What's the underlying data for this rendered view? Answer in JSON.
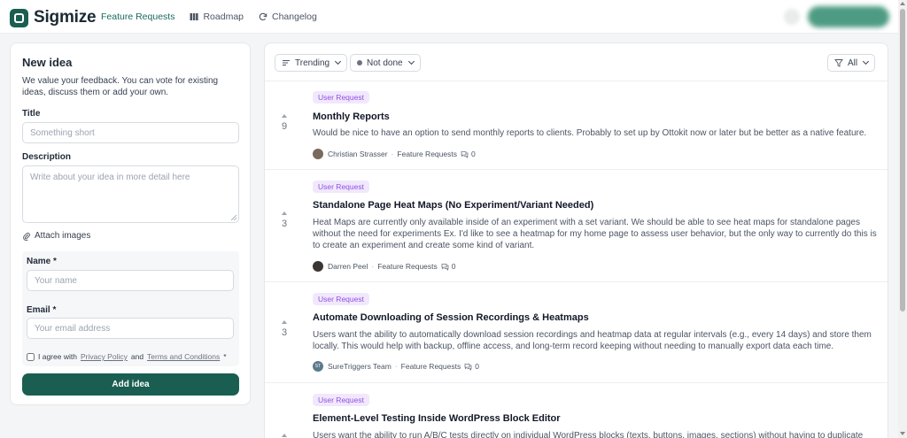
{
  "brand": {
    "name": "Sigmize",
    "color": "#1a5e52"
  },
  "nav": {
    "items": [
      {
        "label": "Feature Requests",
        "icon": "",
        "active": true
      },
      {
        "label": "Roadmap",
        "icon": "roadmap-icon",
        "active": false
      },
      {
        "label": "Changelog",
        "icon": "refresh-icon",
        "active": false
      }
    ]
  },
  "new_idea": {
    "title": "New idea",
    "description": "We value your feedback. You can vote for existing ideas, discuss them or add your own.",
    "title_label": "Title",
    "title_placeholder": "Something short",
    "description_label": "Description",
    "description_placeholder": "Write about your idea in more detail here",
    "attach_label": "Attach images",
    "name_label": "Name *",
    "name_placeholder": "Your name",
    "email_label": "Email *",
    "email_placeholder": "Your email address",
    "agree_prefix": "I agree with",
    "privacy_link": "Privacy Policy",
    "and_text": "and",
    "terms_link": "Terms and Conditions",
    "agree_suffix": "*",
    "submit_label": "Add idea"
  },
  "filters": {
    "sort": "Trending",
    "status": "Not done",
    "scope": "All"
  },
  "posts": [
    {
      "votes": "9",
      "tag": "User Request",
      "title": "Monthly Reports",
      "body": "Would be nice to have an option to send monthly reports to clients. Probably to set up by Ottokit now or later but be better as a native feature.",
      "author": "Christian Strasser",
      "category": "Feature Requests",
      "comments": "0",
      "avatar_color": "#7a6a5c",
      "avatar_text": ""
    },
    {
      "votes": "3",
      "tag": "User Request",
      "title": "Standalone Page Heat Maps (No Experiment/Variant Needed)",
      "body": "Heat Maps are currently only available inside of an experiment with a set variant. We should be able to see heat maps for standalone pages without the need for experiments Ex. I'd like to see a heatmap for my home page to assess user behavior, but the only way to currently do this is to create an experiment and create some kind of variant.",
      "author": "Darren Peel",
      "category": "Feature Requests",
      "comments": "0",
      "avatar_color": "#3b3633",
      "avatar_text": ""
    },
    {
      "votes": "3",
      "tag": "User Request",
      "title": "Automate Downloading of Session Recordings & Heatmaps",
      "body": "Users want the ability to automatically download session recordings and heatmap data at regular intervals (e.g., every 14 days) and store them locally. This would help with backup, offline access, and long-term record keeping without needing to manually export data each time.",
      "author": "SureTriggers Team",
      "category": "Feature Requests",
      "comments": "0",
      "avatar_color": "#5b7a8c",
      "avatar_text": "ST"
    },
    {
      "votes": "",
      "tag": "User Request",
      "title": "Element-Level Testing Inside WordPress Block Editor",
      "body": "Users want the ability to run A/B/C tests directly on individual WordPress blocks (texts, buttons, images, sections) without having to duplicate",
      "author": "",
      "category": "",
      "comments": "",
      "avatar_color": "#999999",
      "avatar_text": ""
    }
  ]
}
